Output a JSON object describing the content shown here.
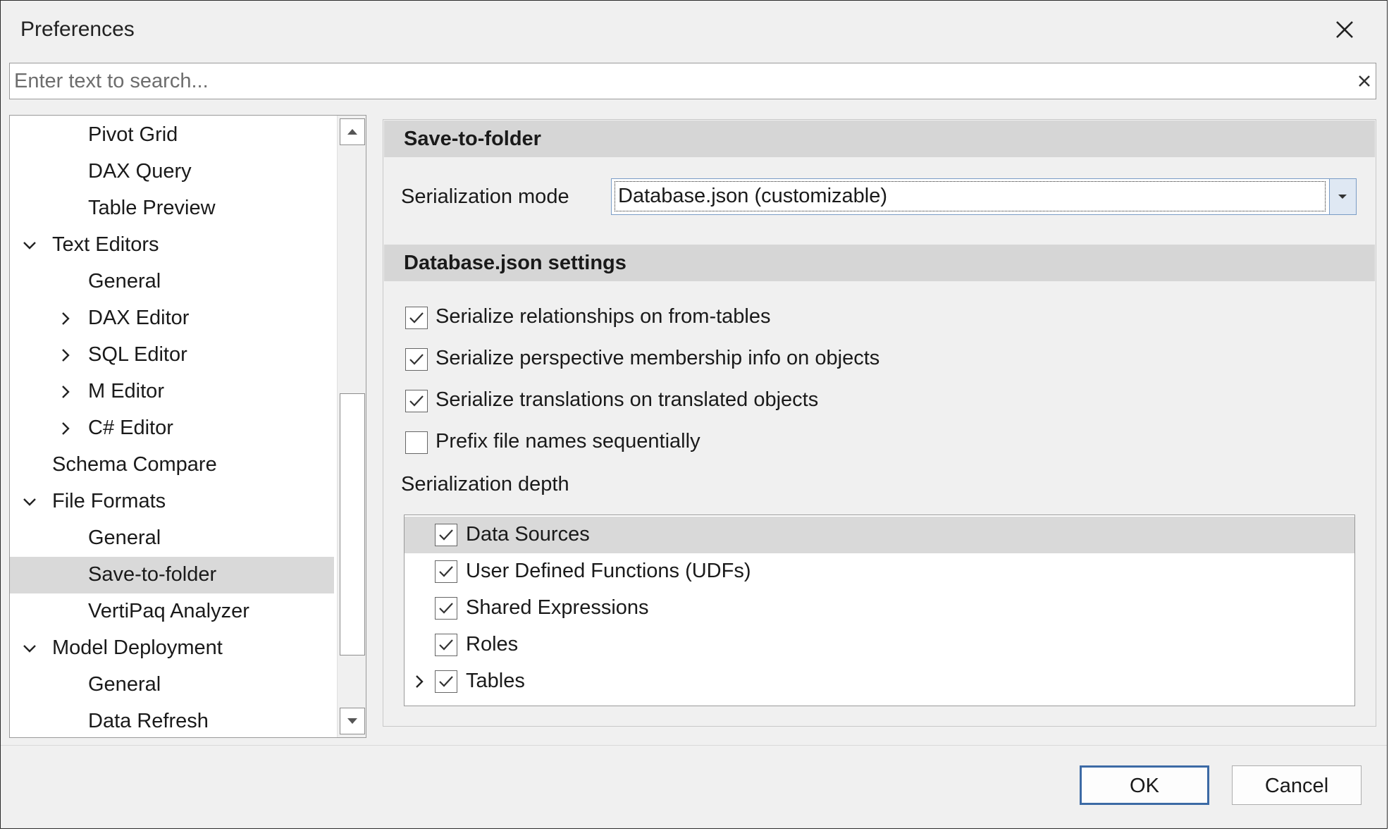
{
  "window": {
    "title": "Preferences"
  },
  "search": {
    "placeholder": "Enter text to search..."
  },
  "tree": {
    "items": [
      {
        "label": "Pivot Grid",
        "level": 2,
        "expander": "none",
        "selected": false
      },
      {
        "label": "DAX Query",
        "level": 2,
        "expander": "none",
        "selected": false
      },
      {
        "label": "Table Preview",
        "level": 2,
        "expander": "none",
        "selected": false
      },
      {
        "label": "Text Editors",
        "level": 1,
        "expander": "expanded",
        "selected": false
      },
      {
        "label": "General",
        "level": 2,
        "expander": "none",
        "selected": false
      },
      {
        "label": "DAX Editor",
        "level": 2,
        "expander": "collapsed",
        "selected": false
      },
      {
        "label": "SQL Editor",
        "level": 2,
        "expander": "collapsed",
        "selected": false
      },
      {
        "label": "M Editor",
        "level": 2,
        "expander": "collapsed",
        "selected": false
      },
      {
        "label": "C# Editor",
        "level": 2,
        "expander": "collapsed",
        "selected": false
      },
      {
        "label": "Schema Compare",
        "level": 1,
        "expander": "none",
        "selected": false
      },
      {
        "label": "File Formats",
        "level": 1,
        "expander": "expanded",
        "selected": false
      },
      {
        "label": "General",
        "level": 2,
        "expander": "none",
        "selected": false
      },
      {
        "label": "Save-to-folder",
        "level": 2,
        "expander": "none",
        "selected": true
      },
      {
        "label": "VertiPaq Analyzer",
        "level": 2,
        "expander": "none",
        "selected": false
      },
      {
        "label": "Model Deployment",
        "level": 1,
        "expander": "expanded",
        "selected": false
      },
      {
        "label": "General",
        "level": 2,
        "expander": "none",
        "selected": false
      },
      {
        "label": "Data Refresh",
        "level": 2,
        "expander": "none",
        "selected": false
      }
    ]
  },
  "save_to_folder": {
    "header": "Save-to-folder",
    "mode_label": "Serialization mode",
    "mode_value": "Database.json (customizable)"
  },
  "db_settings": {
    "header": "Database.json settings",
    "options": [
      {
        "label": "Serialize relationships on from-tables",
        "checked": true
      },
      {
        "label": "Serialize perspective membership info on objects",
        "checked": true
      },
      {
        "label": "Serialize translations on translated objects",
        "checked": true
      },
      {
        "label": "Prefix file names sequentially",
        "checked": false
      }
    ],
    "depth_label": "Serialization depth",
    "depth_items": [
      {
        "label": "Data Sources",
        "checked": true,
        "expander": false,
        "selected": true
      },
      {
        "label": "User Defined Functions (UDFs)",
        "checked": true,
        "expander": false,
        "selected": false
      },
      {
        "label": "Shared Expressions",
        "checked": true,
        "expander": false,
        "selected": false
      },
      {
        "label": "Roles",
        "checked": true,
        "expander": false,
        "selected": false
      },
      {
        "label": "Tables",
        "checked": true,
        "expander": true,
        "selected": false
      }
    ]
  },
  "buttons": {
    "ok": "OK",
    "cancel": "Cancel"
  },
  "colors": {
    "accent": "#3c6aa5",
    "selection": "#d9d9d9",
    "group_header": "#d6d6d6",
    "background": "#f0f0f0"
  },
  "icons": {
    "close": "close-icon",
    "clear": "clear-search-icon",
    "expanded": "chevron-down-icon",
    "collapsed": "chevron-right-icon"
  }
}
